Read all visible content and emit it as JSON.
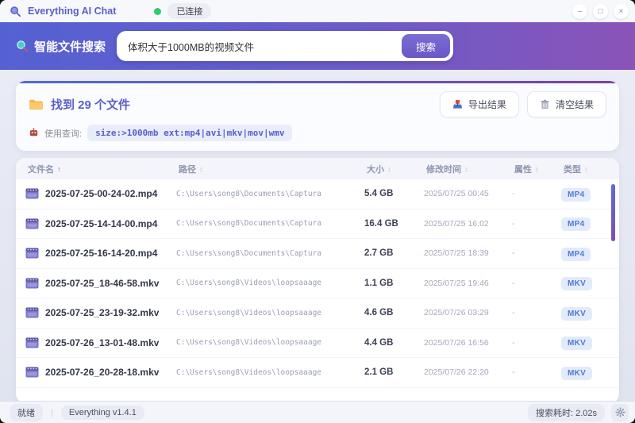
{
  "window": {
    "title": "Everything AI Chat",
    "connection_status": "已连接",
    "controls": {
      "minimize": "–",
      "maximize": "□",
      "close": "×"
    }
  },
  "search": {
    "label": "智能文件搜索",
    "input_value": "体积大于1000MB的视频文件",
    "button_label": "搜索"
  },
  "results": {
    "summary": "找到 29 个文件",
    "export_label": "导出结果",
    "clear_label": "清空结果",
    "query_label": "使用查询:",
    "query_value": "size:>1000mb ext:mp4|avi|mkv|mov|wmv"
  },
  "icons": {
    "app": "search-icon",
    "search_section": "search-icon",
    "results": "folder-icon",
    "query": "robot-icon",
    "export": "export-icon",
    "clear": "trash-icon",
    "file": "film-icon",
    "settings": "gear-icon"
  },
  "colors": {
    "accent_purple": "#5a5fc8",
    "header_gradient_start": "#5561d2",
    "header_gradient_end": "#8a54b8",
    "badge_bg": "#e3ebfa",
    "badge_text": "#4d7ad6",
    "connected_green": "#2ecc71"
  },
  "table": {
    "headers": [
      {
        "label": "文件名",
        "sort": "↑",
        "active": true
      },
      {
        "label": "路径",
        "sort": "↕",
        "active": false
      },
      {
        "label": "大小",
        "sort": "↕",
        "active": false
      },
      {
        "label": "修改时间",
        "sort": "↕",
        "active": false
      },
      {
        "label": "属性",
        "sort": "↕",
        "active": false
      },
      {
        "label": "类型",
        "sort": "↕",
        "active": false
      }
    ],
    "rows": [
      {
        "name": "2025-07-25-00-24-02.mp4",
        "path": "C:\\Users\\song8\\Documents\\Captura",
        "size": "5.4 GB",
        "modified": "2025/07/25 00:45",
        "attr": "-",
        "type": "MP4"
      },
      {
        "name": "2025-07-25-14-14-00.mp4",
        "path": "C:\\Users\\song8\\Documents\\Captura",
        "size": "16.4 GB",
        "modified": "2025/07/25 16:02",
        "attr": "-",
        "type": "MP4"
      },
      {
        "name": "2025-07-25-16-14-20.mp4",
        "path": "C:\\Users\\song8\\Documents\\Captura",
        "size": "2.7 GB",
        "modified": "2025/07/25 18:39",
        "attr": "-",
        "type": "MP4"
      },
      {
        "name": "2025-07-25_18-46-58.mkv",
        "path": "C:\\Users\\song8\\Videos\\loopsaaage",
        "size": "1.1 GB",
        "modified": "2025/07/25 19:46",
        "attr": "-",
        "type": "MKV"
      },
      {
        "name": "2025-07-25_23-19-32.mkv",
        "path": "C:\\Users\\song8\\Videos\\loopsaaage",
        "size": "4.6 GB",
        "modified": "2025/07/26 03:29",
        "attr": "-",
        "type": "MKV"
      },
      {
        "name": "2025-07-26_13-01-48.mkv",
        "path": "C:\\Users\\song8\\Videos\\loopsaaage",
        "size": "4.4 GB",
        "modified": "2025/07/26 16:56",
        "attr": "-",
        "type": "MKV"
      },
      {
        "name": "2025-07-26_20-28-18.mkv",
        "path": "C:\\Users\\song8\\Videos\\loopsaaage",
        "size": "2.1 GB",
        "modified": "2025/07/26 22:20",
        "attr": "-",
        "type": "MKV"
      }
    ]
  },
  "statusbar": {
    "state": "就绪",
    "separator": "|",
    "version": "Everything v1.4.1",
    "elapsed": "搜索耗时: 2.02s"
  }
}
